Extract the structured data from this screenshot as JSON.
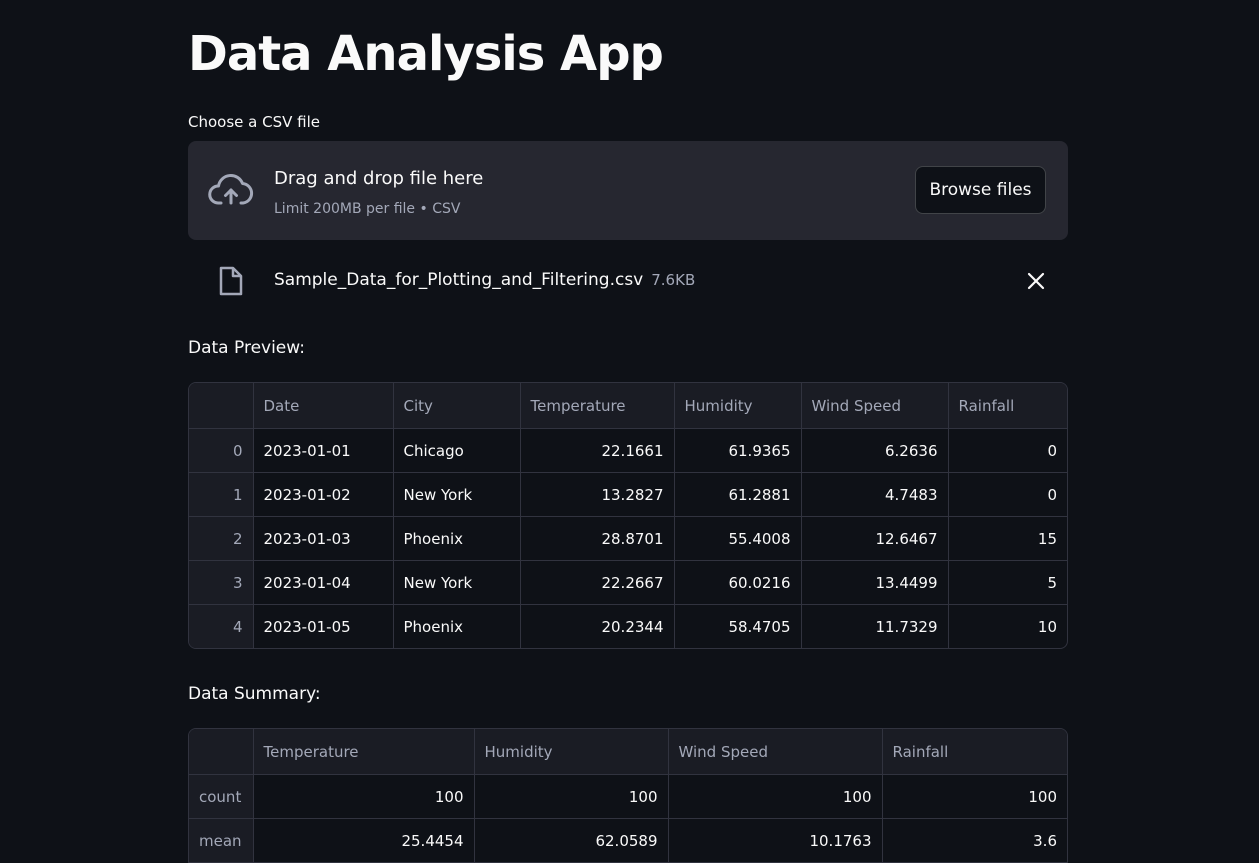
{
  "app": {
    "title": "Data Analysis App"
  },
  "uploader": {
    "label": "Choose a CSV file",
    "drop_text": "Drag and drop file here",
    "limit_text": "Limit 200MB per file • CSV",
    "browse_label": "Browse files",
    "upload_icon": "cloud-upload-icon"
  },
  "uploaded_file": {
    "name": "Sample_Data_for_Plotting_and_Filtering.csv",
    "size": "7.6KB",
    "file_icon": "file-icon",
    "remove_icon": "close-icon"
  },
  "preview": {
    "label": "Data Preview:",
    "columns": [
      "",
      "Date",
      "City",
      "Temperature",
      "Humidity",
      "Wind Speed",
      "Rainfall"
    ],
    "rows": [
      [
        "0",
        "2023-01-01",
        "Chicago",
        "22.1661",
        "61.9365",
        "6.2636",
        "0"
      ],
      [
        "1",
        "2023-01-02",
        "New York",
        "13.2827",
        "61.2881",
        "4.7483",
        "0"
      ],
      [
        "2",
        "2023-01-03",
        "Phoenix",
        "28.8701",
        "55.4008",
        "12.6467",
        "15"
      ],
      [
        "3",
        "2023-01-04",
        "New York",
        "22.2667",
        "60.0216",
        "13.4499",
        "5"
      ],
      [
        "4",
        "2023-01-05",
        "Phoenix",
        "20.2344",
        "58.4705",
        "11.7329",
        "10"
      ]
    ]
  },
  "summary": {
    "label": "Data Summary:",
    "columns": [
      "",
      "Temperature",
      "Humidity",
      "Wind Speed",
      "Rainfall"
    ],
    "rows": [
      [
        "count",
        "100",
        "100",
        "100",
        "100"
      ],
      [
        "mean",
        "25.4454",
        "62.0589",
        "10.1763",
        "3.6"
      ]
    ]
  },
  "theme": {
    "background": "#0e1117",
    "surface": "#262730",
    "header_bg": "#1a1c24",
    "border": "#31333f",
    "text": "#fafafa",
    "muted_text": "#a3a8b8"
  }
}
